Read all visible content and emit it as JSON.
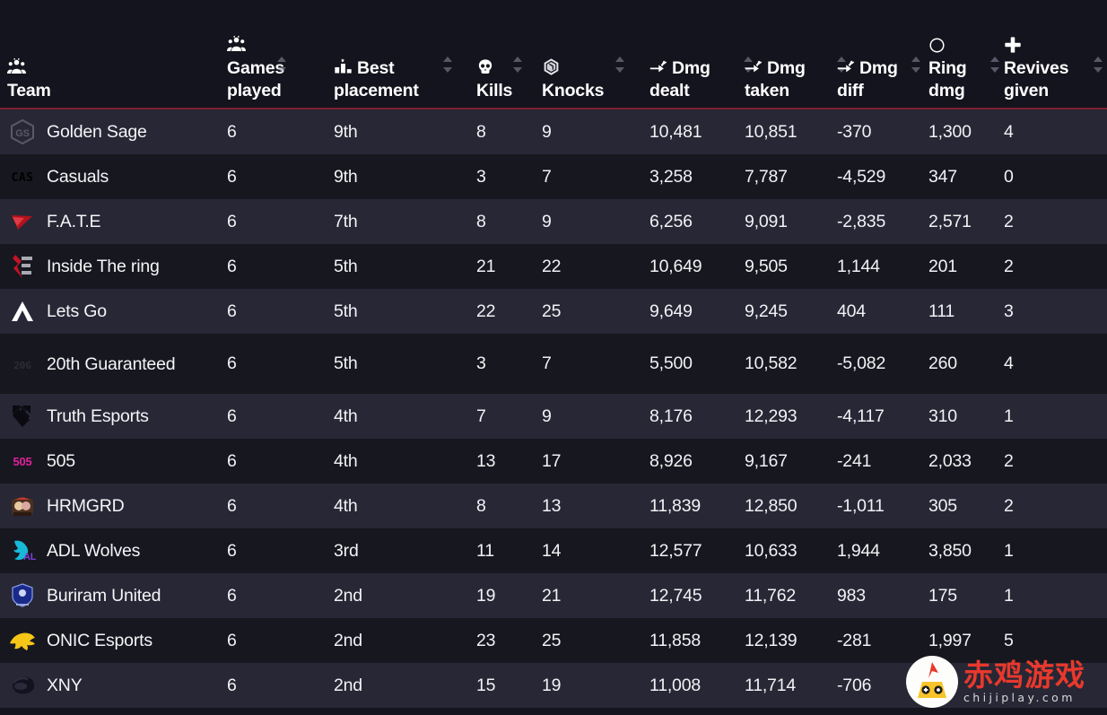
{
  "theme": {
    "page_bg": "#15151f",
    "header_bg": "#14141e",
    "row_bg": "#272736",
    "row_alt_bg": "#17171f",
    "accent_rule": "#7b2030",
    "text": "#f2f2f5"
  },
  "table": {
    "columns": [
      {
        "key": "team",
        "label": "Team",
        "icon": "team-group-icon",
        "sortable": false
      },
      {
        "key": "games",
        "label": "Games\nplayed",
        "icon": "team-group-icon",
        "sortable": true
      },
      {
        "key": "placement",
        "label": "Best\nplacement",
        "icon": "podium-icon",
        "sortable": true
      },
      {
        "key": "kills",
        "label": "Kills",
        "icon": "skull-icon",
        "sortable": true
      },
      {
        "key": "knocks",
        "label": "Knocks",
        "icon": "knock-fist-icon",
        "sortable": true
      },
      {
        "key": "dmg_dealt",
        "label": "Dmg\ndealt",
        "icon": "damage-arrow-icon",
        "sortable": true
      },
      {
        "key": "dmg_taken",
        "label": "Dmg\ntaken",
        "icon": "damage-arrow-icon",
        "sortable": true
      },
      {
        "key": "dmg_diff",
        "label": "Dmg\ndiff",
        "icon": "damage-arrow-icon",
        "sortable": true
      },
      {
        "key": "ring_dmg",
        "label": "Ring\ndmg",
        "icon": "ring-circle-icon",
        "sortable": true
      },
      {
        "key": "revives",
        "label": "Revives\ngiven",
        "icon": "plus-cross-icon",
        "sortable": true
      }
    ],
    "rows": [
      {
        "team": "Golden Sage",
        "logo": "GS",
        "games": "6",
        "placement": "9th",
        "kills": "8",
        "knocks": "9",
        "dmg_dealt": "10,481",
        "dmg_taken": "10,851",
        "dmg_diff": "-370",
        "ring_dmg": "1,300",
        "revives": "4"
      },
      {
        "team": "Casuals",
        "logo": "CAS",
        "games": "6",
        "placement": "9th",
        "kills": "3",
        "knocks": "7",
        "dmg_dealt": "3,258",
        "dmg_taken": "7,787",
        "dmg_diff": "-4,529",
        "ring_dmg": "347",
        "revives": "0"
      },
      {
        "team": "F.A.T.E",
        "logo": "FATE",
        "games": "6",
        "placement": "7th",
        "kills": "8",
        "knocks": "9",
        "dmg_dealt": "6,256",
        "dmg_taken": "9,091",
        "dmg_diff": "-2,835",
        "ring_dmg": "2,571",
        "revives": "2"
      },
      {
        "team": "Inside The ring",
        "logo": "ITR",
        "games": "6",
        "placement": "5th",
        "kills": "21",
        "knocks": "22",
        "dmg_dealt": "10,649",
        "dmg_taken": "9,505",
        "dmg_diff": "1,144",
        "ring_dmg": "201",
        "revives": "2"
      },
      {
        "team": "Lets Go",
        "logo": "LG",
        "games": "6",
        "placement": "5th",
        "kills": "22",
        "knocks": "25",
        "dmg_dealt": "9,649",
        "dmg_taken": "9,245",
        "dmg_diff": "404",
        "ring_dmg": "111",
        "revives": "3"
      },
      {
        "team": "20th Guaranteed",
        "logo": "20G",
        "games": "6",
        "placement": "5th",
        "kills": "3",
        "knocks": "7",
        "dmg_dealt": "5,500",
        "dmg_taken": "10,582",
        "dmg_diff": "-5,082",
        "ring_dmg": "260",
        "revives": "4"
      },
      {
        "team": "Truth Esports",
        "logo": "TE",
        "games": "6",
        "placement": "4th",
        "kills": "7",
        "knocks": "9",
        "dmg_dealt": "8,176",
        "dmg_taken": "12,293",
        "dmg_diff": "-4,117",
        "ring_dmg": "310",
        "revives": "1"
      },
      {
        "team": "505",
        "logo": "505",
        "games": "6",
        "placement": "4th",
        "kills": "13",
        "knocks": "17",
        "dmg_dealt": "8,926",
        "dmg_taken": "9,167",
        "dmg_diff": "-241",
        "ring_dmg": "2,033",
        "revives": "2"
      },
      {
        "team": "HRMGRD",
        "logo": "HRM",
        "games": "6",
        "placement": "4th",
        "kills": "8",
        "knocks": "13",
        "dmg_dealt": "11,839",
        "dmg_taken": "12,850",
        "dmg_diff": "-1,011",
        "ring_dmg": "305",
        "revives": "2"
      },
      {
        "team": "ADL Wolves",
        "logo": "ADL",
        "games": "6",
        "placement": "3rd",
        "kills": "11",
        "knocks": "14",
        "dmg_dealt": "12,577",
        "dmg_taken": "10,633",
        "dmg_diff": "1,944",
        "ring_dmg": "3,850",
        "revives": "1"
      },
      {
        "team": "Buriram United",
        "logo": "BRU",
        "games": "6",
        "placement": "2nd",
        "kills": "19",
        "knocks": "21",
        "dmg_dealt": "12,745",
        "dmg_taken": "11,762",
        "dmg_diff": "983",
        "ring_dmg": "175",
        "revives": "1"
      },
      {
        "team": "ONIC Esports",
        "logo": "ONIC",
        "games": "6",
        "placement": "2nd",
        "kills": "23",
        "knocks": "25",
        "dmg_dealt": "11,858",
        "dmg_taken": "12,139",
        "dmg_diff": "-281",
        "ring_dmg": "1,997",
        "revives": "5"
      },
      {
        "team": "XNY",
        "logo": "XNY",
        "games": "6",
        "placement": "2nd",
        "kills": "15",
        "knocks": "19",
        "dmg_dealt": "11,008",
        "dmg_taken": "11,714",
        "dmg_diff": "-706",
        "ring_dmg": "",
        "revives": ""
      }
    ]
  },
  "watermark": {
    "title": "赤鸡游戏",
    "url": "chijiplay.com"
  }
}
